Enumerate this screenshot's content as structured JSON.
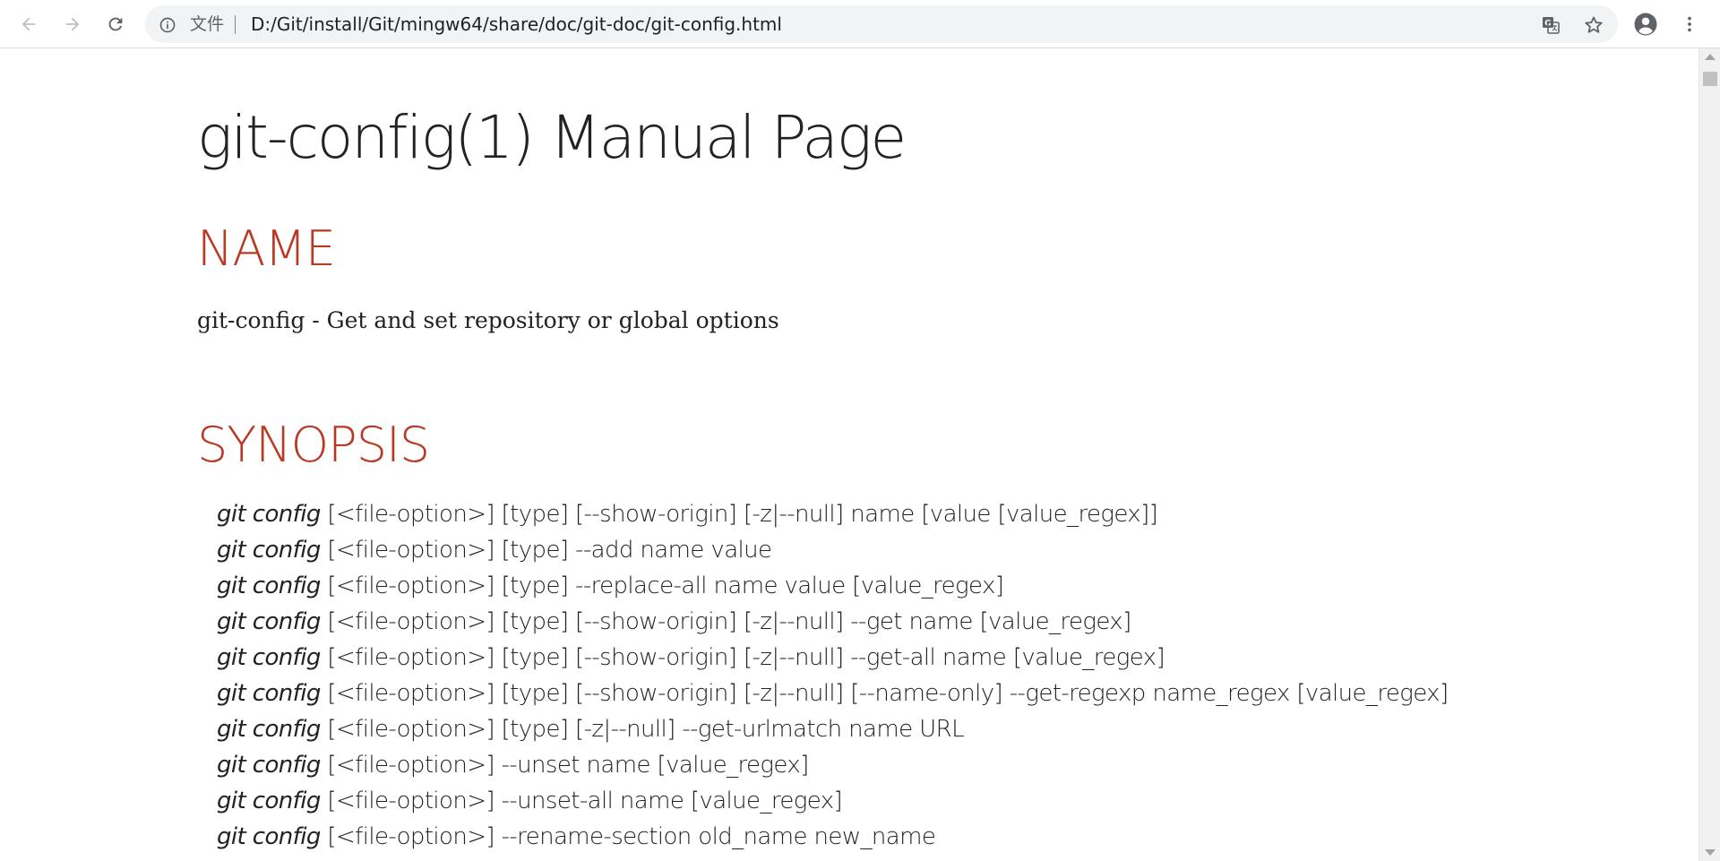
{
  "browser": {
    "scheme_label": "文件",
    "url": "D:/Git/install/Git/mingw64/share/doc/git-doc/git-config.html",
    "icons": {
      "back": "arrow-left-icon",
      "forward": "arrow-right-icon",
      "reload": "reload-icon",
      "info": "info-circle-icon",
      "translate": "translate-icon",
      "bookmark": "star-icon",
      "profile": "account-circle-icon",
      "menu": "kebab-menu-icon"
    }
  },
  "page": {
    "title": "git-config(1) Manual Page",
    "sections": {
      "name": {
        "heading": "NAME",
        "text": "git-config - Get and set repository or global options"
      },
      "synopsis": {
        "heading": "SYNOPSIS",
        "lines": [
          {
            "cmd": "git config",
            "args": " [<file-option>] [type] [--show-origin] [-z|--null] name [value [value_regex]]"
          },
          {
            "cmd": "git config",
            "args": " [<file-option>] [type] --add name value"
          },
          {
            "cmd": "git config",
            "args": " [<file-option>] [type] --replace-all name value [value_regex]"
          },
          {
            "cmd": "git config",
            "args": " [<file-option>] [type] [--show-origin] [-z|--null] --get name [value_regex]"
          },
          {
            "cmd": "git config",
            "args": " [<file-option>] [type] [--show-origin] [-z|--null] --get-all name [value_regex]"
          },
          {
            "cmd": "git config",
            "args": " [<file-option>] [type] [--show-origin] [-z|--null] [--name-only] --get-regexp name_regex [value_regex]"
          },
          {
            "cmd": "git config",
            "args": " [<file-option>] [type] [-z|--null] --get-urlmatch name URL"
          },
          {
            "cmd": "git config",
            "args": " [<file-option>] --unset name [value_regex]"
          },
          {
            "cmd": "git config",
            "args": " [<file-option>] --unset-all name [value_regex]"
          },
          {
            "cmd": "git config",
            "args": " [<file-option>] --rename-section old_name new_name"
          }
        ]
      }
    }
  },
  "colors": {
    "heading_accent": "#ba3925",
    "body_text": "#222222",
    "omnibox_bg": "#f1f3f4",
    "toolbar_icon": "#5f6368"
  }
}
